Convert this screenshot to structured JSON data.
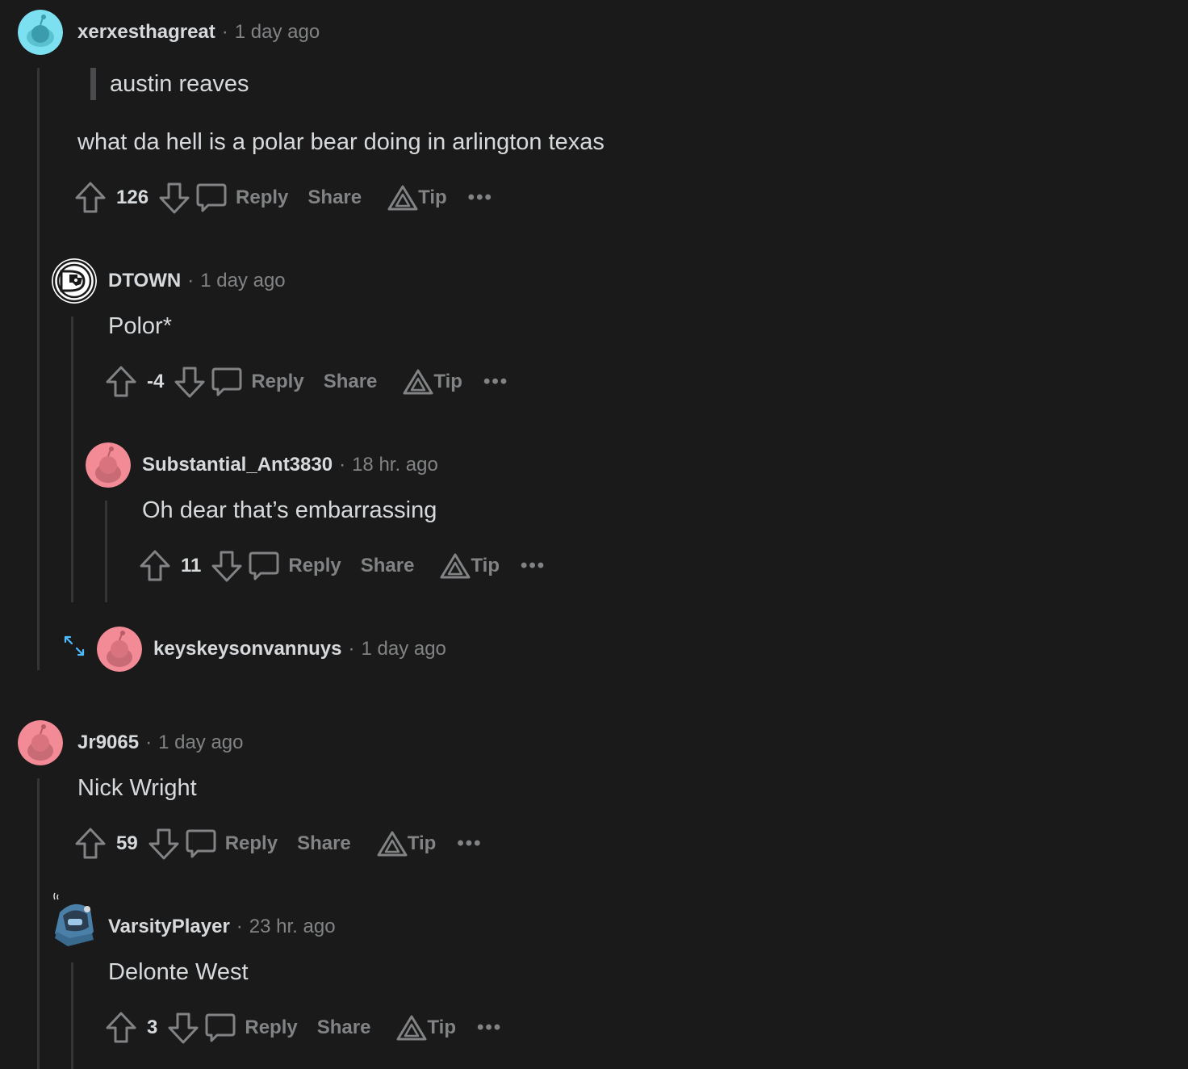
{
  "labels": {
    "reply": "Reply",
    "share": "Share",
    "tip": "Tip",
    "more": "•••",
    "sep": "·"
  },
  "comments": [
    {
      "username": "xerxesthagreat",
      "time": "1 day ago",
      "quote": "austin reaves",
      "body": "what da hell is a polar bear doing in arlington texas",
      "score": "126",
      "avatar_color": "#7ce0f0"
    },
    {
      "username": "DTOWN",
      "time": "1 day ago",
      "body": "Polor*",
      "score": "-4"
    },
    {
      "username": "Substantial_Ant3830",
      "time": "18 hr. ago",
      "body": "Oh dear that’s embarrassing",
      "score": "11",
      "avatar_color": "#f28b95"
    },
    {
      "username": "keyskeysonvannuys",
      "time": "1 day ago",
      "collapsed": true,
      "avatar_color": "#f28b95"
    },
    {
      "username": "Jr9065",
      "time": "1 day ago",
      "body": "Nick Wright",
      "score": "59",
      "avatar_color": "#f28b95"
    },
    {
      "username": "VarsityPlayer",
      "time": "23 hr. ago",
      "body": "Delonte West",
      "score": "3"
    }
  ],
  "colors": {
    "background": "#1a1a1b",
    "text": "#d7dadc",
    "muted": "#818384",
    "thread_line": "#343536",
    "expand_icon": "#4fbcff"
  }
}
